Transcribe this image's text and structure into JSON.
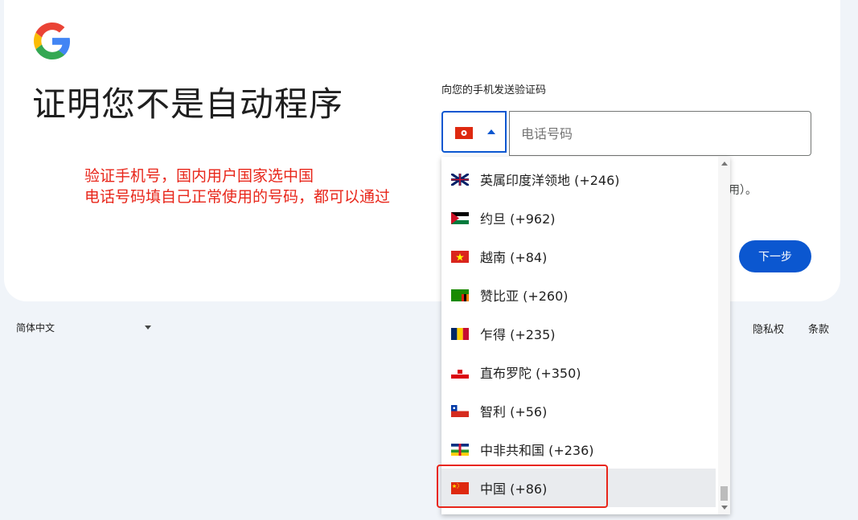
{
  "heading": "证明您不是自动程序",
  "annotation": {
    "line1": "验证手机号，国内用户国家选中国",
    "line2": "电话号码填自己正常使用的号码，都可以通过"
  },
  "form": {
    "prompt": "向您的手机发送验证码",
    "phone_placeholder": "电话号码",
    "helper_text_fragment": "用）。",
    "next_label": "下一步"
  },
  "dropdown": {
    "items": [
      {
        "label": "英属印度洋领地 (+246)",
        "flag": "british-indian-ocean-territory"
      },
      {
        "label": "约旦 (+962)",
        "flag": "jordan"
      },
      {
        "label": "越南 (+84)",
        "flag": "vietnam"
      },
      {
        "label": "赞比亚 (+260)",
        "flag": "zambia"
      },
      {
        "label": "乍得 (+235)",
        "flag": "chad"
      },
      {
        "label": "直布罗陀 (+350)",
        "flag": "gibraltar"
      },
      {
        "label": "智利 (+56)",
        "flag": "chile"
      },
      {
        "label": "中非共和国 (+236)",
        "flag": "central-african-republic"
      },
      {
        "label": "中国 (+86)",
        "flag": "china",
        "selected": true
      }
    ]
  },
  "footer": {
    "language": "简体中文",
    "privacy": "隐私权",
    "terms": "条款"
  },
  "colors": {
    "accent": "#0b57d0",
    "annotation": "#e8261a",
    "page_bg": "#f0f4f9"
  }
}
